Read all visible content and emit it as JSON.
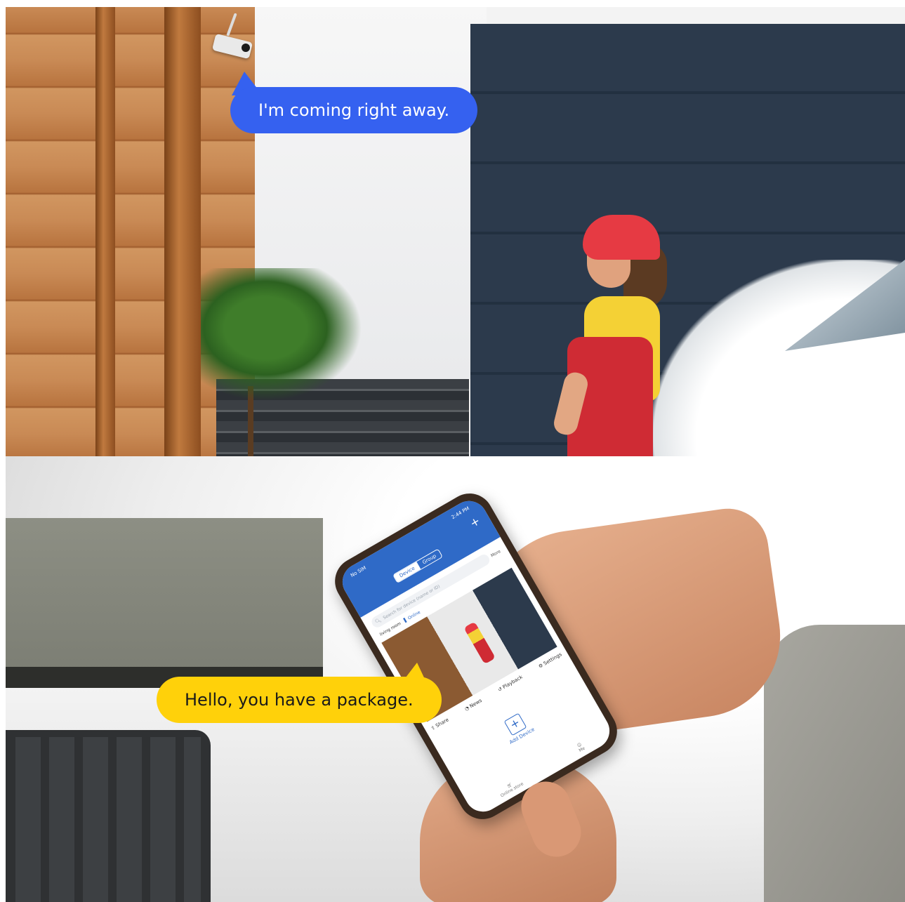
{
  "bubbles": {
    "top": "I'm coming right away.",
    "bottom": "Hello, you have a package."
  },
  "phone": {
    "status_left": "No SIM",
    "status_time": "2:44 PM",
    "tabs": [
      "Device",
      "Group"
    ],
    "search_placeholder": "Search for device (name or ID)",
    "more_label": "More",
    "camera_name": "living room",
    "camera_status": "Online",
    "actions": [
      "Share",
      "News",
      "Playback",
      "Settings"
    ],
    "add_device_label": "Add Device",
    "tabbar": [
      "Online store",
      "Me"
    ]
  },
  "colors": {
    "bubble_blue": "#3561f0",
    "bubble_yellow": "#ffd10a",
    "app_blue": "#2f6ac7"
  },
  "icons": {
    "search": "search-icon",
    "plus": "plus-icon",
    "signal": "signal-icon",
    "share": "share-icon",
    "news": "bell-icon",
    "playback": "playback-icon",
    "settings": "gear-icon",
    "store": "cart-icon",
    "me": "user-icon"
  }
}
